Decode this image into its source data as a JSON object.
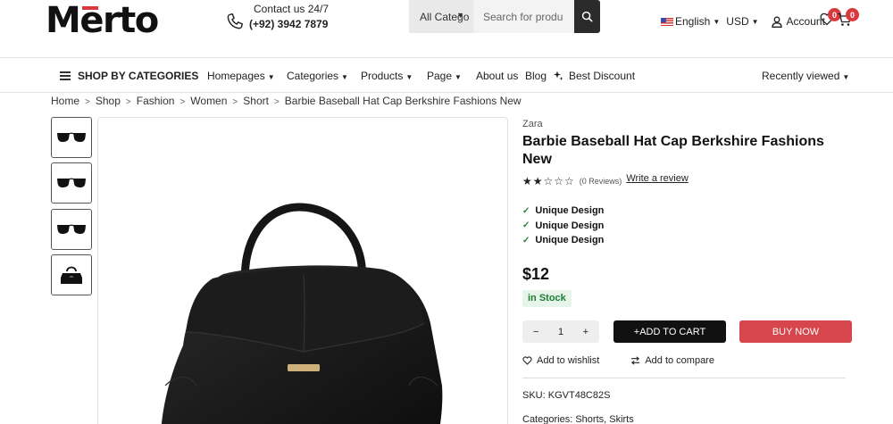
{
  "header": {
    "logo_pre": "M",
    "logo_accent": "e",
    "logo_post": "rto",
    "contact_label": "Contact us 24/7",
    "contact_phone": "(+92) 3942 7879",
    "category_select": "All Catego",
    "search_placeholder": "Search for produ",
    "language": "English",
    "currency": "USD",
    "account": "Account",
    "wishlist_count": "0",
    "cart_count": "0"
  },
  "nav": {
    "shop_by": "SHOP BY CATEGORIES",
    "items": [
      "Homepages",
      "Categories",
      "Products",
      "Page",
      "About us",
      "Blog",
      "Best Discount"
    ],
    "recently_viewed": "Recently viewed"
  },
  "breadcrumb": [
    "Home",
    "Shop",
    "Fashion",
    "Women",
    "Short",
    "Barbie Baseball Hat Cap Berkshire Fashions New"
  ],
  "product": {
    "brand": "Zara",
    "title": "Barbie Baseball Hat Cap Berkshire Fashions New",
    "stars": "★★☆☆☆",
    "rating": 2,
    "reviews": "(0 Reviews)",
    "write_review": "Write a review",
    "features": [
      "Unique Design",
      "Unique Design",
      "Unique Design"
    ],
    "price": "$12",
    "stock": "in Stock",
    "qty_minus": "−",
    "qty": "1",
    "qty_plus": "+",
    "add_to_cart": "+ADD TO CART",
    "buy_now": "BUY NOW",
    "add_wishlist": "Add to wishlist",
    "add_compare": "Add to compare",
    "sku_label": "SKU:",
    "sku": "KGVT48C82S",
    "categories_label": "Categories:",
    "categories": "Shorts, Skirts"
  },
  "colors": {
    "accent_red": "#d6464c",
    "dark": "#111111",
    "stock_green": "#1e7b34"
  }
}
